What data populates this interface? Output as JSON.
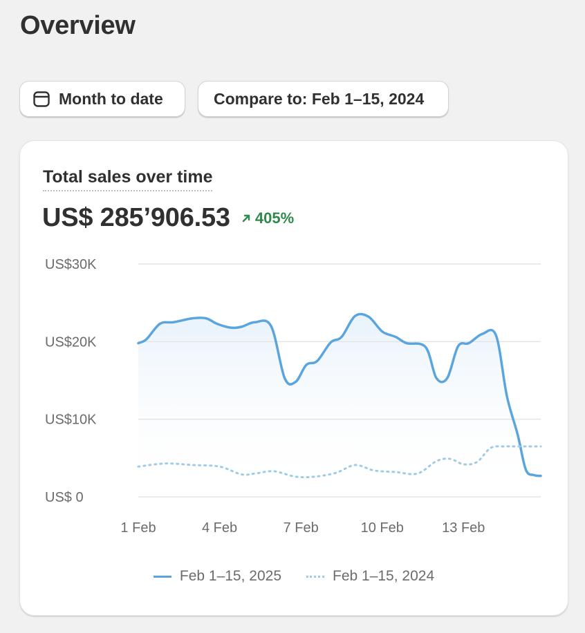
{
  "header": {
    "title": "Overview"
  },
  "toolbar": {
    "date_range_label": "Month to date",
    "compare_label": "Compare to: Feb 1–15, 2024"
  },
  "card": {
    "title": "Total sales over time",
    "total": "US$ 285’906.53",
    "delta": "405%",
    "delta_color": "#2f8a4a"
  },
  "chart_data": {
    "type": "line",
    "title": "Total sales over time",
    "xlabel": "",
    "ylabel": "",
    "ylim": [
      0,
      30000
    ],
    "x_ticks": [
      "1 Feb",
      "4 Feb",
      "7 Feb",
      "10 Feb",
      "13 Feb"
    ],
    "y_ticks": [
      "US$ 0",
      "US$10K",
      "US$20K",
      "US$30K"
    ],
    "y_tick_values": [
      0,
      10000,
      20000,
      30000
    ],
    "xlim": [
      1,
      15.85
    ],
    "grid": true,
    "legend": "bottom",
    "series": [
      {
        "name": "Feb 1–15, 2025",
        "style": "solid",
        "color": "#5aa5dd",
        "x": [
          1.0,
          1.3,
          1.8,
          2.3,
          3.0,
          3.5,
          3.9,
          4.4,
          4.8,
          5.3,
          5.9,
          6.4,
          6.8,
          7.2,
          7.6,
          8.1,
          8.5,
          9.0,
          9.5,
          10.0,
          10.5,
          10.9,
          11.6,
          12.0,
          12.4,
          12.8,
          13.2,
          13.7,
          14.2,
          14.6,
          15.0,
          15.3,
          15.6,
          15.85
        ],
        "y": [
          19800,
          20300,
          22300,
          22500,
          23000,
          23000,
          22300,
          21800,
          21900,
          22500,
          22000,
          15300,
          14800,
          17000,
          17500,
          19900,
          20600,
          23300,
          23200,
          21300,
          20600,
          19800,
          19300,
          15300,
          15300,
          19400,
          19800,
          21000,
          20800,
          13000,
          8000,
          3500,
          2800,
          2700
        ]
      },
      {
        "name": "Feb 1–15, 2024",
        "style": "dotted",
        "color": "#9fcbe8",
        "x": [
          1.0,
          2.0,
          3.0,
          4.0,
          4.8,
          5.3,
          6.0,
          6.8,
          7.5,
          8.3,
          9.0,
          9.7,
          10.5,
          11.3,
          12.0,
          12.5,
          13.0,
          13.5,
          14.0,
          14.5,
          15.0,
          15.85
        ],
        "y": [
          3900,
          4300,
          4100,
          3900,
          2900,
          3000,
          3300,
          2600,
          2600,
          3100,
          4100,
          3400,
          3200,
          3000,
          4600,
          4900,
          4200,
          4500,
          6300,
          6500,
          6500,
          6500
        ]
      }
    ]
  }
}
